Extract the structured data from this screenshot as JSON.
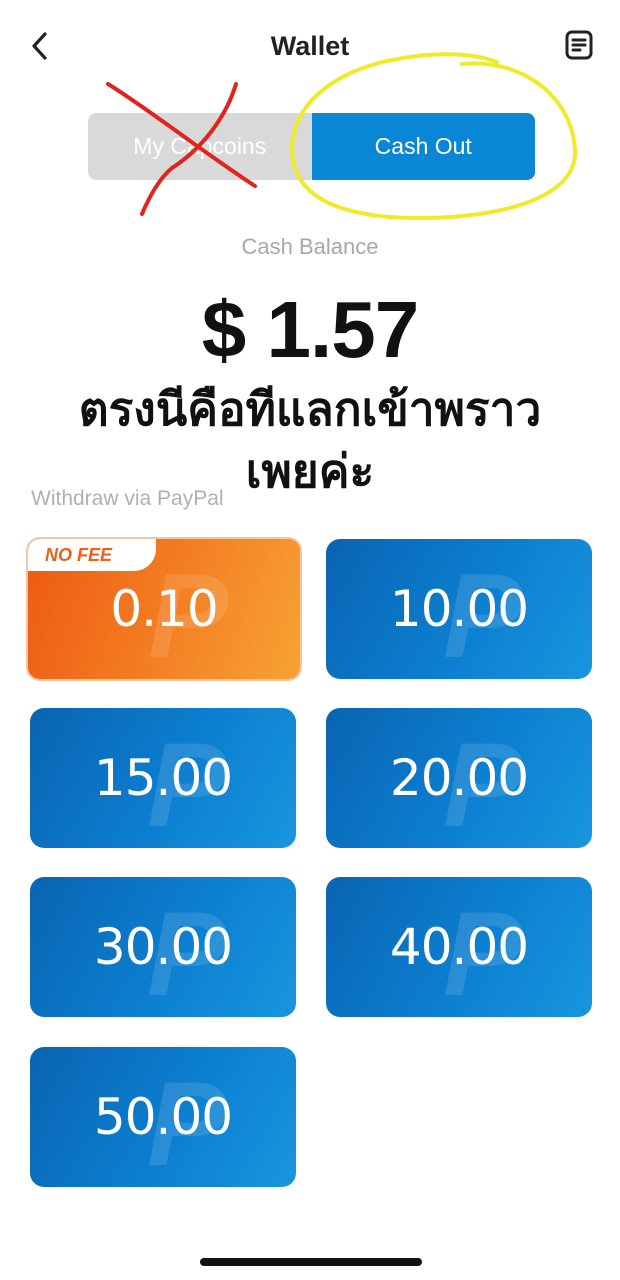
{
  "header": {
    "title": "Wallet",
    "back_icon": "chevron-left-icon",
    "receipt_icon": "receipt-icon"
  },
  "tabs": [
    {
      "label": "My Capcoins",
      "active": false
    },
    {
      "label": "Cash Out",
      "active": true
    }
  ],
  "balance": {
    "label": "Cash Balance",
    "amount": "$ 1.57"
  },
  "annotation_text": {
    "line1": "ตรงนีคือทีแลกเข้าพราว",
    "line2": "เพยค่ะ"
  },
  "withdraw_label": "Withdraw via PayPal",
  "cashout_options": [
    {
      "amount": "0.10",
      "badge": "NO FEE"
    },
    {
      "amount": "10.00"
    },
    {
      "amount": "15.00"
    },
    {
      "amount": "20.00"
    },
    {
      "amount": "30.00"
    },
    {
      "amount": "40.00"
    },
    {
      "amount": "50.00"
    }
  ],
  "colors": {
    "accent_blue": "#0a86d6",
    "orange": "#f37d22",
    "annotation_red": "#e0231c",
    "annotation_yellow": "#f1ea2a"
  }
}
